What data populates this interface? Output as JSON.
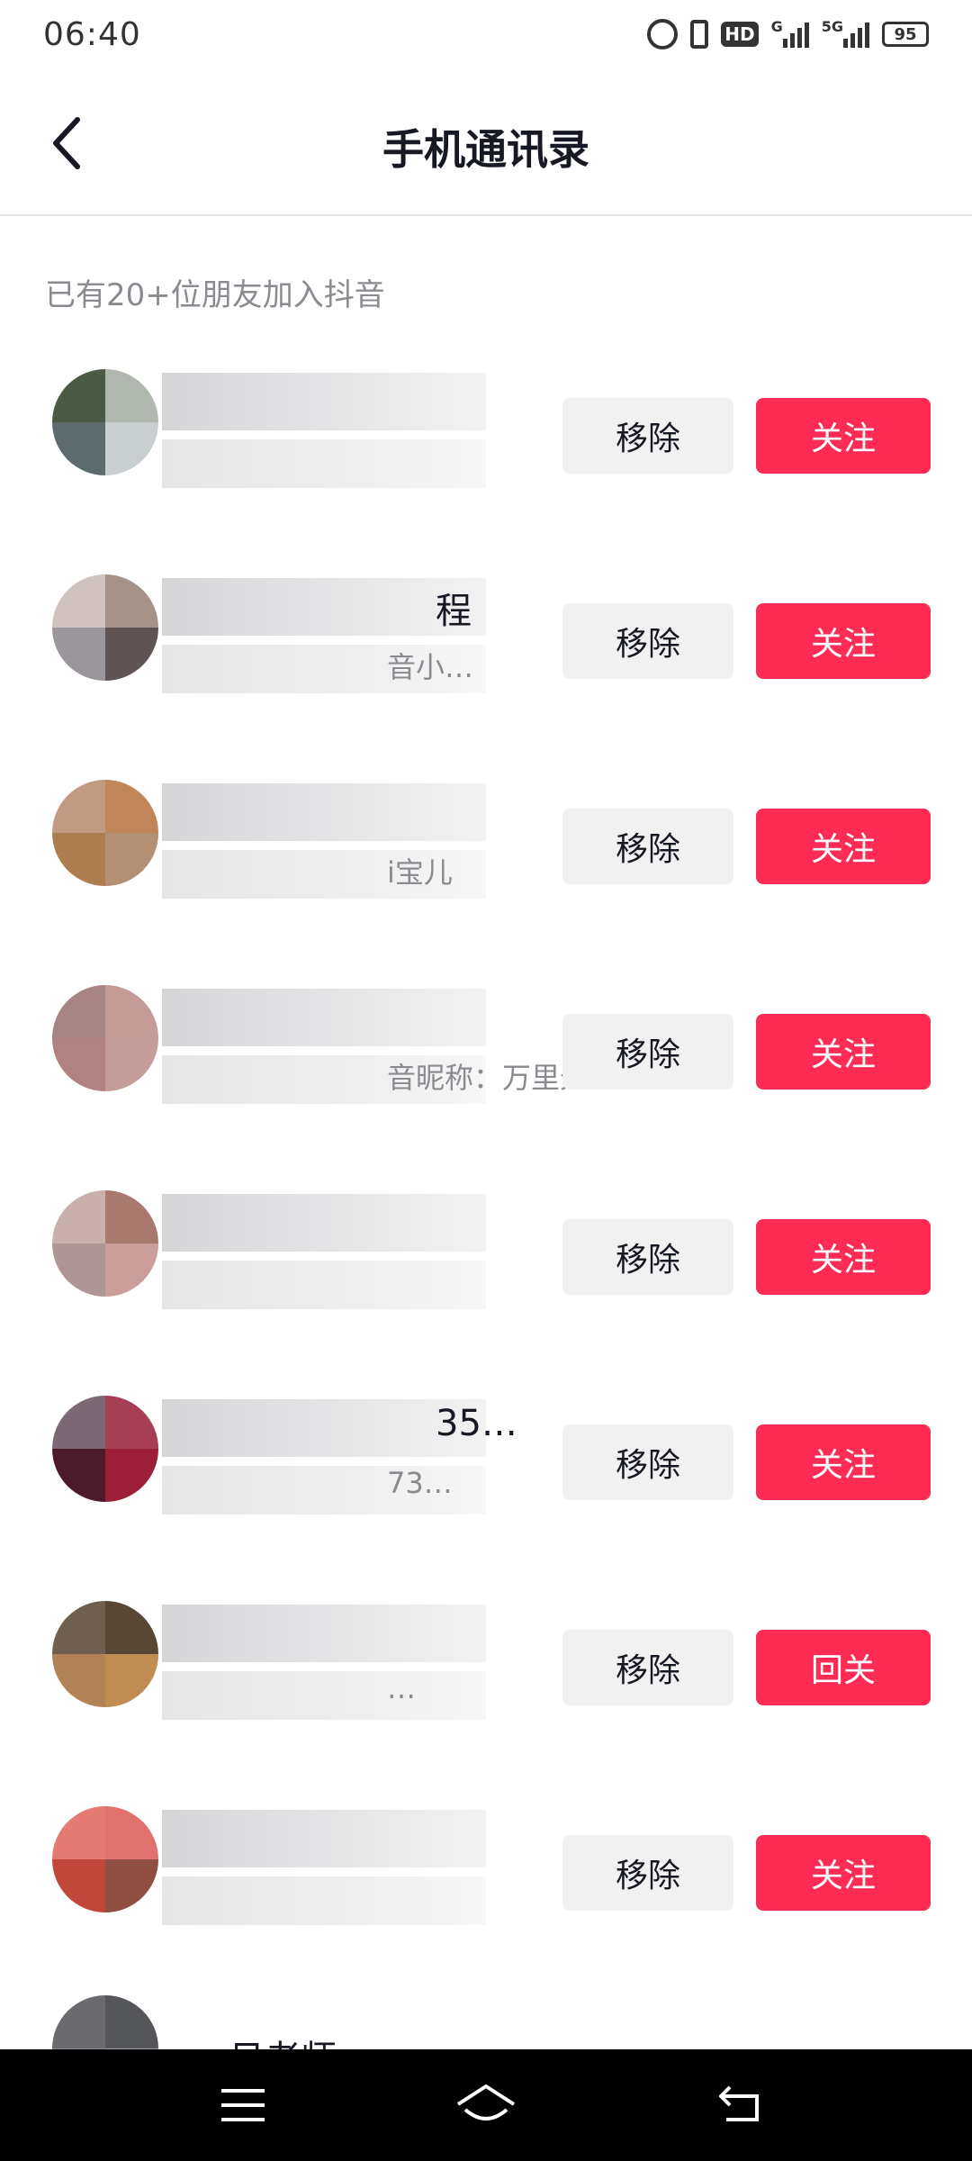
{
  "status_bar": {
    "time": "06:40",
    "hd_label": "HD",
    "network_g": "G",
    "network_5g": "5G",
    "battery": "95",
    "icons": [
      "alarm-icon",
      "vibrate-icon",
      "hd-icon",
      "signal-icon",
      "signal-5g-icon",
      "battery-icon"
    ]
  },
  "header": {
    "title": "手机通讯录",
    "back_icon": "chevron-left-icon"
  },
  "subtitle": "已有20+位朋友加入抖音",
  "contacts": [
    {
      "name_tail": "",
      "sub_tail": "",
      "remove_label": "移除",
      "follow_label": "关注",
      "avatar_colors": [
        "#4a5a44",
        "#b0b7ae",
        "#5e6b6e",
        "#c9ced0"
      ]
    },
    {
      "name_tail": "程",
      "sub_tail": "音小…",
      "remove_label": "移除",
      "follow_label": "关注",
      "avatar_colors": [
        "#cfc2bf",
        "#a59389",
        "#9b959c",
        "#5f5453"
      ]
    },
    {
      "name_tail": "",
      "sub_tail": "i宝儿",
      "remove_label": "移除",
      "follow_label": "关注",
      "avatar_colors": [
        "#c29a82",
        "#c0865a",
        "#ad7d50",
        "#b39073"
      ]
    },
    {
      "name_tail": "",
      "sub_tail": "音昵称：万里无…",
      "remove_label": "移除",
      "follow_label": "关注",
      "avatar_colors": [
        "#a88484",
        "#c49b96",
        "#b28282",
        "#c39d99"
      ]
    },
    {
      "name_tail": "",
      "sub_tail": "",
      "remove_label": "移除",
      "follow_label": "关注",
      "avatar_colors": [
        "#c9b0ac",
        "#a9786f",
        "#ae9596",
        "#cc9e9b"
      ]
    },
    {
      "name_tail": "35…",
      "sub_tail": "73…",
      "remove_label": "移除",
      "follow_label": "关注",
      "avatar_colors": [
        "#7b6a75",
        "#a63f56",
        "#4c1a2b",
        "#9c1e39"
      ]
    },
    {
      "name_tail": "",
      "sub_tail": "…",
      "remove_label": "移除",
      "follow_label": "回关",
      "avatar_colors": [
        "#6e5f51",
        "#594736",
        "#b08256",
        "#bf8c52"
      ]
    },
    {
      "name_tail": "",
      "sub_tail": "",
      "remove_label": "移除",
      "follow_label": "关注",
      "avatar_colors": [
        "#e47a72",
        "#e1716d",
        "#c1473b",
        "#914e43"
      ]
    }
  ],
  "partial_row": {
    "name_tail": "日老师"
  },
  "nav_bar": {
    "icons": [
      "menu-icon",
      "home-icon",
      "back-icon"
    ]
  }
}
